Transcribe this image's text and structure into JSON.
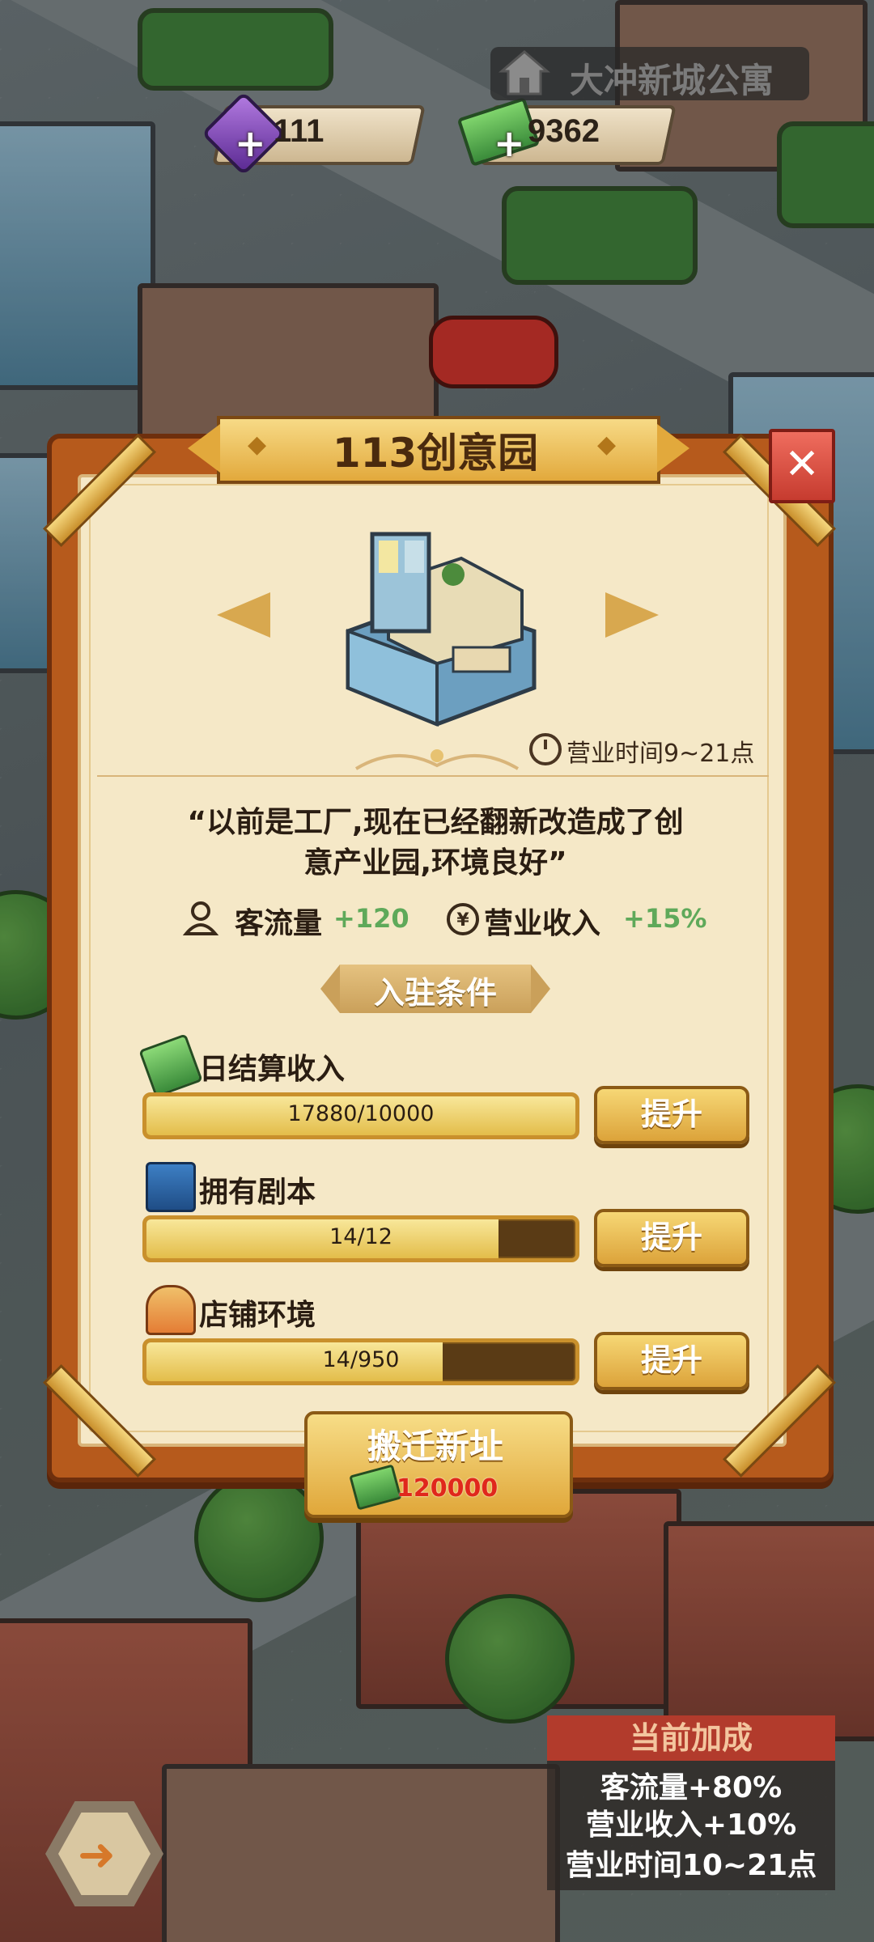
{
  "hud": {
    "gems": "111",
    "cash": "9362",
    "location": "大冲新城公寓"
  },
  "panel": {
    "title": "113创意园",
    "close_label": "✕",
    "hours": "营业时间9~21点",
    "description_line1": "“以前是工厂,现在已经翻新改造成了创",
    "description_line2": "意产业园,环境良好”",
    "traffic_label": "客流量",
    "traffic_value": "+120",
    "income_label": "营业收入",
    "income_value": "+15%",
    "requirements_title": "入驻条件"
  },
  "requirements": [
    {
      "label": "日结算收入",
      "progress_text": "17880/10000",
      "fill": 1.0,
      "button": "提升"
    },
    {
      "label": "拥有剧本",
      "progress_text": "14/12",
      "fill": 0.82,
      "button": "提升"
    },
    {
      "label": "店铺环境",
      "progress_text": "14/950",
      "fill": 0.69,
      "button": "提升"
    }
  ],
  "move": {
    "label": "搬迁新址",
    "cost": "120000"
  },
  "bonus": {
    "title": "当前加成",
    "line1": "客流量+80%",
    "line2": "营业收入+10%",
    "line3": "营业时间10~21点"
  },
  "colors": {
    "accent": "#e0a73a",
    "positive": "#5fa95a",
    "cost": "#e0281c"
  }
}
